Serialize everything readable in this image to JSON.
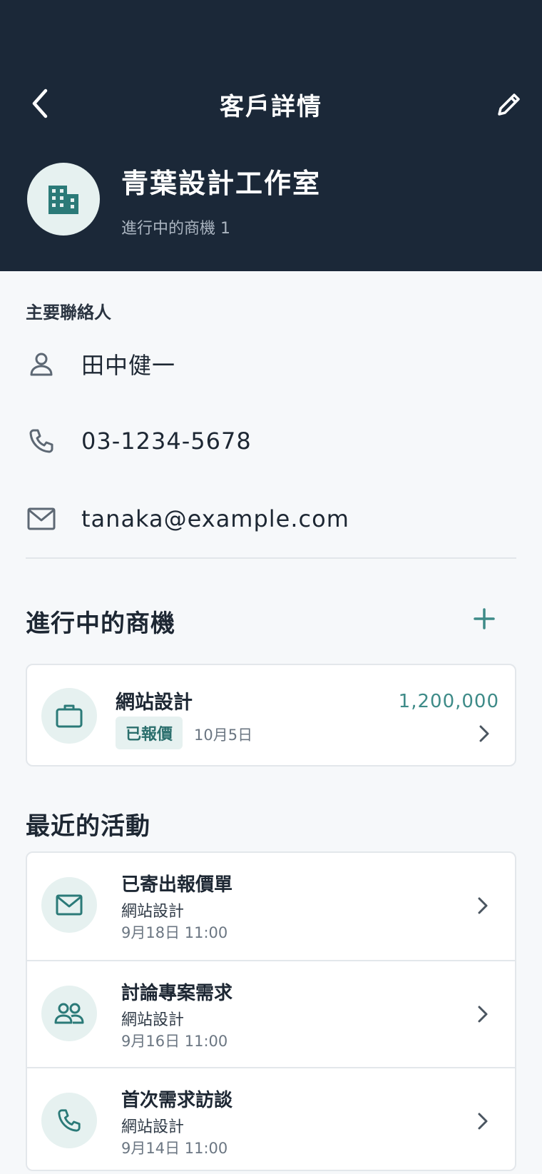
{
  "header": {
    "title": "客戶詳情",
    "company_name": "青葉設計工作室",
    "company_subtitle": "進行中的商機 1",
    "icons": {
      "back": "chevron-left-icon",
      "edit": "pencil-icon",
      "company": "building-icon"
    }
  },
  "contact": {
    "section_label": "主要聯絡人",
    "name": "田中健一",
    "phone": "03-1234-5678",
    "email": "tanaka@example.com"
  },
  "deals": {
    "title": "進行中的商機",
    "items": [
      {
        "name": "網站設計",
        "status": "已報價",
        "date": "10月5日",
        "amount": "1,200,000"
      }
    ]
  },
  "activities": {
    "title": "最近的活動",
    "items": [
      {
        "icon": "mail-icon",
        "title": "已寄出報價單",
        "deal": "網站設計",
        "time": "9月18日 11:00"
      },
      {
        "icon": "people-icon",
        "title": "討論專案需求",
        "deal": "網站設計",
        "time": "9月16日 11:00"
      },
      {
        "icon": "phone-icon",
        "title": "首次需求訪談",
        "deal": "網站設計",
        "time": "9月14日 11:00"
      }
    ]
  },
  "colors": {
    "header_bg": "#1b2838",
    "accent": "#3e8b88",
    "badge_bg": "#e6f1f0",
    "page_bg": "#f6f8fa"
  }
}
